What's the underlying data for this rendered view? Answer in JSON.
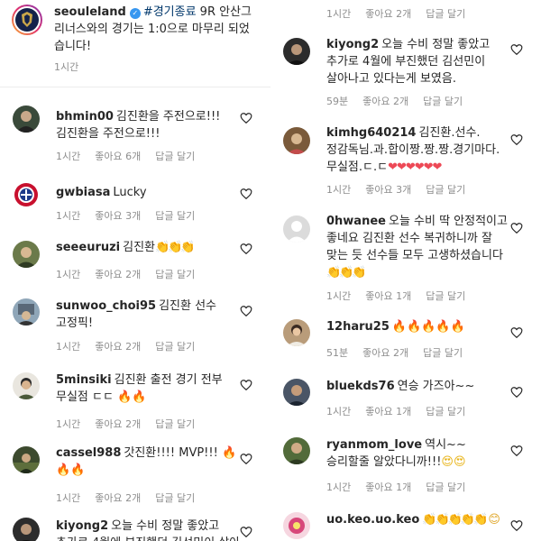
{
  "post": {
    "username": "seouleland",
    "hashtag": "#경기종료",
    "caption": " 9R 안산그리너스와의 경기는 1:0으로 마무리 되었습니다!",
    "time": "1시간"
  },
  "labels": {
    "likes_prefix": "좋아요",
    "likes_suffix": "개",
    "reply": "답글 달기"
  },
  "left_comments": [
    {
      "username": "bhmin00",
      "text": "김진환을 주전으로!!! 김진환을 주전으로!!!",
      "emoji": "",
      "time": "1시간",
      "likes": "6"
    },
    {
      "username": "gwbiasa",
      "text": "Lucky",
      "emoji": "",
      "time": "1시간",
      "likes": "3"
    },
    {
      "username": "seeeuruzi",
      "text": "김진환",
      "emoji": "👏👏👏",
      "time": "1시간",
      "likes": "2"
    },
    {
      "username": "sunwoo_choi95",
      "text": "김진환 선수 고정픽!",
      "emoji": "",
      "time": "1시간",
      "likes": "2"
    },
    {
      "username": "5minsiki",
      "text": "김진환 출전 경기 전부 무실점 ㄷㄷ ",
      "emoji": "🔥🔥",
      "time": "1시간",
      "likes": "2"
    },
    {
      "username": "cassel988",
      "text": "갓진환!!!! MVP!!! ",
      "emoji": "🔥🔥🔥",
      "time": "1시간",
      "likes": "2"
    },
    {
      "username": "kiyong2",
      "text": "오늘 수비 정말 좋았고 추가로 4월에 부진했던 김선민이 살아",
      "emoji": "",
      "time": "",
      "likes": ""
    }
  ],
  "right_top": {
    "time": "1시간",
    "likes": "2"
  },
  "right_comments": [
    {
      "username": "kiyong2",
      "text": "오늘 수비 정말 좋았고 추가로 4월에 부진했던 김선민이 살아나고 있다는게 보였음.",
      "emoji": "",
      "time": "59분",
      "likes": "2"
    },
    {
      "username": "kimhg640214",
      "text": "김진환.선수.정감독님.과.합이짱.짱.짱.경기마다.무실점.ㄷ.ㄷ",
      "emoji": "❤❤❤❤❤❤",
      "time": "1시간",
      "likes": "3"
    },
    {
      "username": "0hwanee",
      "text": "오늘 수비 딱 안정적이고 좋네요 김진환 선수 복귀하니까 잘 맞는 듯 선수들 모두 고생하셨습니다 ",
      "emoji": "👏👏👏",
      "time": "1시간",
      "likes": "1"
    },
    {
      "username": "12haru25",
      "text": "",
      "emoji": "🔥🔥🔥🔥🔥",
      "time": "51분",
      "likes": "2"
    },
    {
      "username": "bluekds76",
      "text": "연승 가즈아~~",
      "emoji": "",
      "time": "1시간",
      "likes": "1"
    },
    {
      "username": "ryanmom_love",
      "text": "역시~~ 승리할줄 알았다니까!!!",
      "emoji": "😍😍",
      "time": "1시간",
      "likes": "1"
    },
    {
      "username": "uo.keo.uo.keo",
      "text": "",
      "emoji": "👏👏👏👏👏 😊",
      "time": "",
      "likes": ""
    }
  ],
  "colors": {
    "text": "#262626",
    "meta": "#8e8e8e",
    "hashtag": "#00376b",
    "verified": "#3897f0",
    "heart_red": "#ed4956",
    "fire": "#f56a16"
  }
}
